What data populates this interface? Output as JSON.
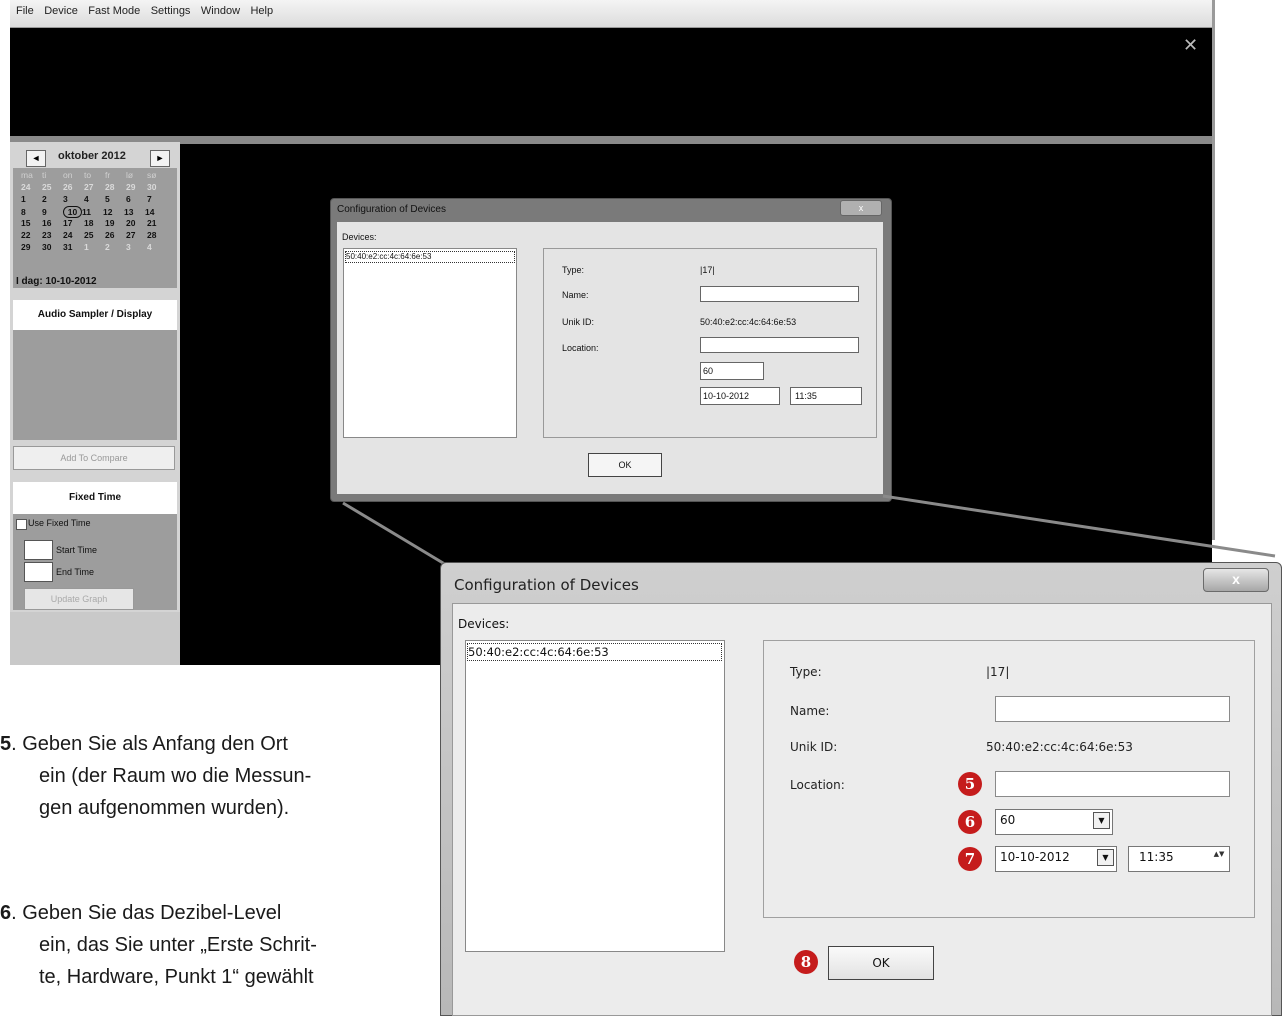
{
  "app": {
    "menu": [
      "File",
      "Device",
      "Fast Mode",
      "Settings",
      "Window",
      "Help"
    ],
    "close_glyph": "✕"
  },
  "calendar": {
    "prev": "◄",
    "next": "►",
    "title": "oktober 2012",
    "weekdays": [
      "ma",
      "ti",
      "on",
      "to",
      "fr",
      "lø",
      "sø"
    ],
    "weeks": [
      [
        "24",
        "25",
        "26",
        "27",
        "28",
        "29",
        "30"
      ],
      [
        "1",
        "2",
        "3",
        "4",
        "5",
        "6",
        "7"
      ],
      [
        "8",
        "9",
        "10",
        "11",
        "12",
        "13",
        "14"
      ],
      [
        "15",
        "16",
        "17",
        "18",
        "19",
        "20",
        "21"
      ],
      [
        "22",
        "23",
        "24",
        "25",
        "26",
        "27",
        "28"
      ],
      [
        "29",
        "30",
        "31",
        "1",
        "2",
        "3",
        "4"
      ]
    ],
    "today_label": "I dag: 10-10-2012"
  },
  "panel": {
    "audio_title": "Audio Sampler / Display",
    "add_compare": "Add To Compare",
    "fixed_title": "Fixed Time",
    "use_fixed": "Use Fixed Time",
    "start_time": "Start Time",
    "end_time": "End Time",
    "update_graph": "Update Graph"
  },
  "dialog": {
    "title": "Configuration of Devices",
    "close_glyph": "x",
    "devices_label": "Devices:",
    "device_item": "50:40:e2:cc:4c:64:6e:53",
    "type_label": "Type:",
    "type_value": "|17|",
    "name_label": "Name:",
    "name_value": "",
    "unik_label": "Unik ID:",
    "unik_value": "50:40:e2:cc:4c:64:6e:53",
    "location_label": "Location:",
    "location_value": "",
    "level_value": "60",
    "date_value": "10-10-2012",
    "time_value": "11:35",
    "ok": "OK",
    "combo_glyph": "▼",
    "spin_glyph": "▲▼"
  },
  "badges": [
    "5",
    "6",
    "7",
    "8"
  ],
  "instructions": [
    {
      "num": "5",
      "text": ". Geben Sie als Anfang den Ort",
      "line2": "ein (der Raum wo die Messun-",
      "line3": "gen aufgenommen wurden)."
    },
    {
      "num": "6",
      "text": ". Geben Sie das Dezibel-Level",
      "line2": "ein, das Sie unter „Erste Schrit-",
      "line3": "te, Hardware, Punkt 1“ gewählt"
    }
  ]
}
